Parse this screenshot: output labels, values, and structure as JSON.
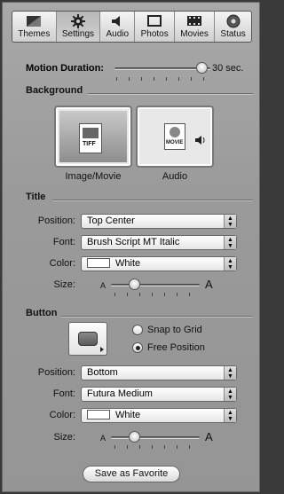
{
  "toolbar": {
    "tabs": [
      {
        "label": "Themes",
        "icon": "themes-icon"
      },
      {
        "label": "Settings",
        "icon": "gear-icon"
      },
      {
        "label": "Audio",
        "icon": "speaker-icon"
      },
      {
        "label": "Photos",
        "icon": "photos-icon"
      },
      {
        "label": "Movies",
        "icon": "film-icon"
      },
      {
        "label": "Status",
        "icon": "disc-icon"
      }
    ],
    "active": "Settings"
  },
  "motion": {
    "label": "Motion Duration:",
    "value_text": "30 sec.",
    "level": 0.95
  },
  "background": {
    "title": "Background",
    "image_caption": "Image/Movie",
    "image_badge": "TIFF",
    "audio_caption": "Audio",
    "audio_badge": "MOVIE"
  },
  "title_section": {
    "title": "Title",
    "position_label": "Position:",
    "position_value": "Top Center",
    "font_label": "Font:",
    "font_value": "Brush Script MT Italic",
    "color_label": "Color:",
    "color_value": "White",
    "size_label": "Size:",
    "size_small": "A",
    "size_large": "A",
    "size_level": 0.3
  },
  "button_section": {
    "title": "Button",
    "snap_label": "Snap to Grid",
    "free_label": "Free Position",
    "selected": "Free Position",
    "position_label": "Position:",
    "position_value": "Bottom",
    "font_label": "Font:",
    "font_value": "Futura Medium",
    "color_label": "Color:",
    "color_value": "White",
    "size_label": "Size:",
    "size_small": "A",
    "size_large": "A",
    "size_level": 0.3
  },
  "save_favorite_label": "Save as Favorite",
  "colors": {
    "panel": "#9f9f9f",
    "window_bg": "#3a3a3a"
  }
}
